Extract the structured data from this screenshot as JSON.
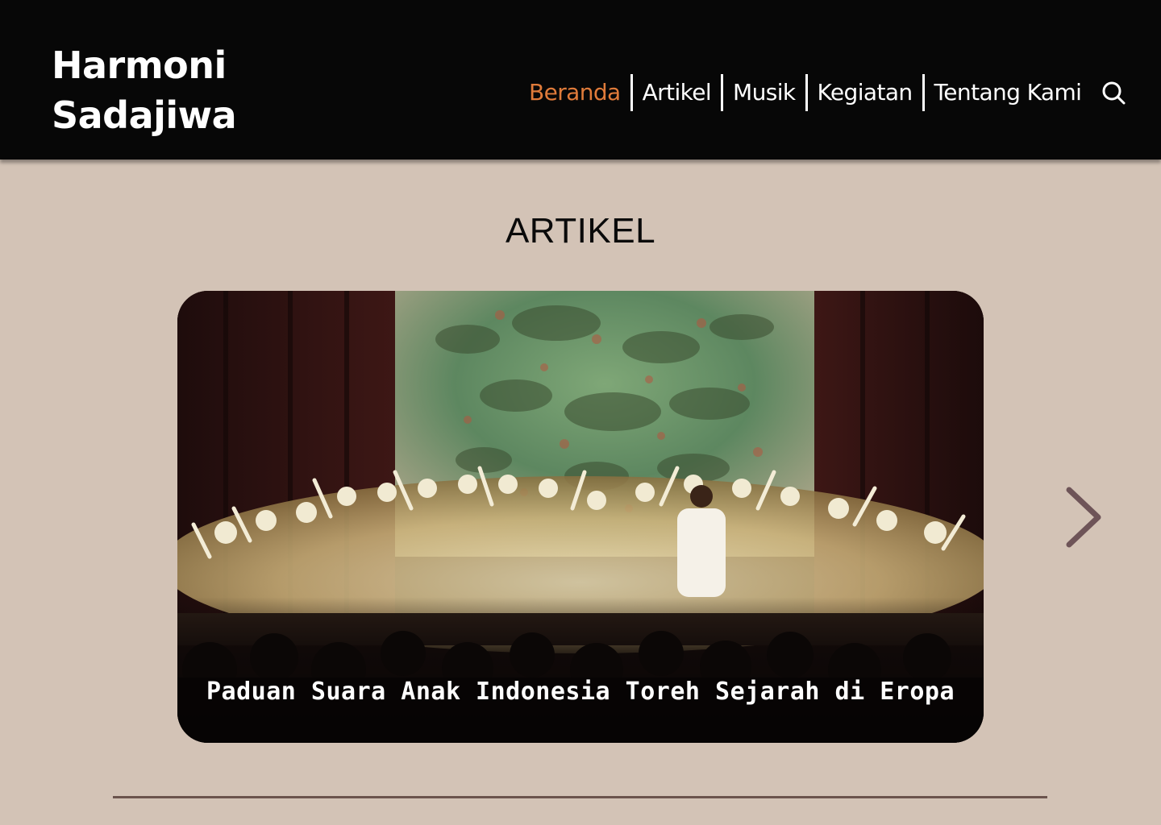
{
  "brand": {
    "line1": "Harmoni",
    "line2": "Sadajiwa"
  },
  "nav": {
    "items": [
      {
        "label": "Beranda",
        "active": true
      },
      {
        "label": "Artikel",
        "active": false
      },
      {
        "label": "Musik",
        "active": false
      },
      {
        "label": "Kegiatan",
        "active": false
      },
      {
        "label": "Tentang Kami",
        "active": false
      }
    ],
    "search_icon": "search-icon",
    "active_color": "#e07b3a"
  },
  "main": {
    "heading": "ARTIKEL",
    "carousel": {
      "slides": [
        {
          "title": "Paduan Suara Anak Indonesia Toreh Sejarah di Eropa",
          "image": "choir-performance-on-stage-photo"
        }
      ],
      "next_icon": "chevron-right-icon"
    }
  },
  "colors": {
    "navbar_bg": "#070707",
    "page_bg": "#d3c3b6",
    "divider": "#6b544d",
    "chevron": "#6e5458"
  }
}
